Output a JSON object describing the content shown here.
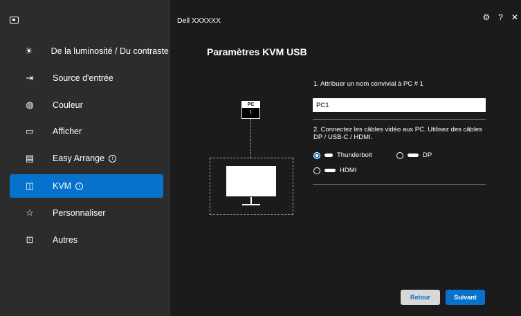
{
  "window": {
    "title": "Dell XXXXXX"
  },
  "sidebar": {
    "items": [
      {
        "label": "De la luminosité / Du contraste",
        "icon": "brightness-icon",
        "glyph": "☀",
        "active": false,
        "info": false
      },
      {
        "label": "Source d'entrée",
        "icon": "input-source-icon",
        "glyph": "⇥",
        "active": false,
        "info": false
      },
      {
        "label": "Couleur",
        "icon": "color-icon",
        "glyph": "◍",
        "active": false,
        "info": false
      },
      {
        "label": "Afficher",
        "icon": "display-icon",
        "glyph": "▭",
        "active": false,
        "info": false
      },
      {
        "label": "Easy Arrange",
        "icon": "easy-arrange-icon",
        "glyph": "▤",
        "active": false,
        "info": true
      },
      {
        "label": "KVM",
        "icon": "kvm-icon",
        "glyph": "◫",
        "active": true,
        "info": true
      },
      {
        "label": "Personnaliser",
        "icon": "star-icon",
        "glyph": "☆",
        "active": false,
        "info": false
      },
      {
        "label": "Autres",
        "icon": "others-icon",
        "glyph": "⊡",
        "active": false,
        "info": false
      }
    ]
  },
  "main": {
    "title": "Paramètres KVM USB",
    "pc_badge": {
      "label": "PC",
      "number": "1"
    },
    "step1_label": "1. Attribuer un nom convivial à PC # 1",
    "pc_name_value": "PC1",
    "step2_label": "2. Connectez les câbles vidéo aux PC. Utilisez des câbles DP / USB-C / HDMI.",
    "options": [
      {
        "label": "Thunderbolt",
        "selected": true
      },
      {
        "label": "DP",
        "selected": false
      },
      {
        "label": "HDMI",
        "selected": false
      }
    ],
    "back_label": "Retour",
    "next_label": "Suivant"
  },
  "colors": {
    "accent": "#0672cb",
    "sidebar_bg": "#2c2c2c",
    "main_bg": "#1b1b1b"
  }
}
